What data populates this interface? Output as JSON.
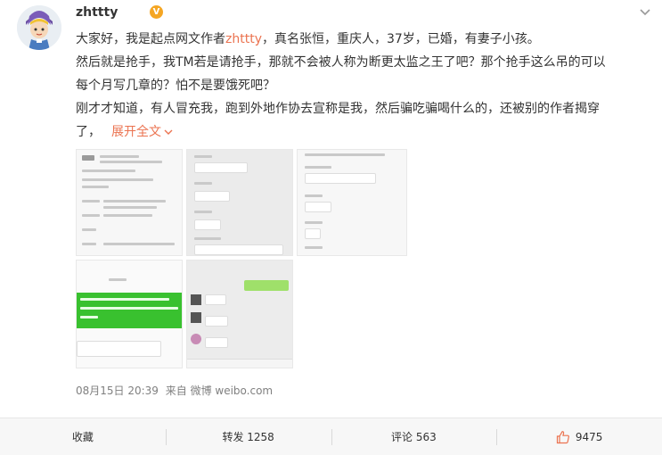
{
  "post": {
    "author": "zhttty",
    "verified_badge": "V",
    "lines": {
      "l1_pre": "大家好，我是起点网文作者",
      "l1_mention": "zhttty",
      "l1_post": "，真名张恒，重庆人，37岁，已婚，有妻子小孩。",
      "l2": "然后就是抢手，我TM若是请抢手，那就不会被人称为断更太监之王了吧？那个抢手这么吊的可以",
      "l3": "每个月写几章的？怕不是要饿死吧？",
      "l4": "刚才才知道，有人冒充我，跑到外地作协去宣称是我，然后骗吃骗喝什么的，还被别的作者揭穿",
      "l5": "了，"
    },
    "expand_label": "展开全文",
    "timestamp": "08月15日 20:39",
    "source": "来自 微博 weibo.com"
  },
  "actions": {
    "favorite": "收藏",
    "repost": "转发 1258",
    "comment": "评论 563",
    "like": "9475"
  },
  "colors": {
    "accent": "#eb7350",
    "vip_badge": "#f5a623"
  }
}
